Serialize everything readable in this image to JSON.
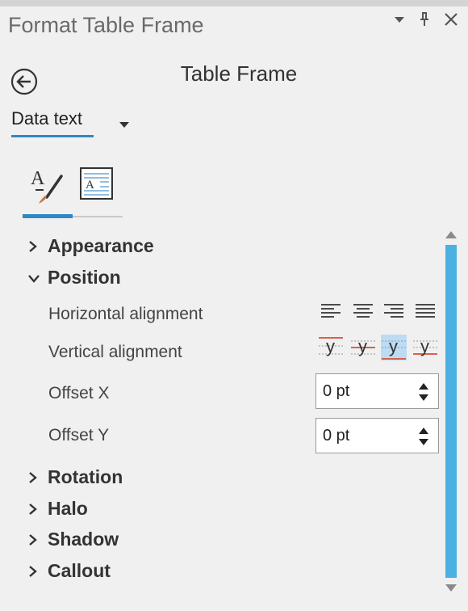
{
  "window": {
    "title": "Format Table Frame"
  },
  "header": {
    "section_title": "Table Frame"
  },
  "element_selector": {
    "value": "Data text"
  },
  "tool_tabs": [
    {
      "icon": "text-symbol-icon",
      "active": true
    },
    {
      "icon": "text-properties-icon",
      "active": false
    }
  ],
  "groups": {
    "appearance": {
      "label": "Appearance",
      "expanded": false
    },
    "position": {
      "label": "Position",
      "expanded": true
    },
    "rotation": {
      "label": "Rotation",
      "expanded": false
    },
    "halo": {
      "label": "Halo",
      "expanded": false
    },
    "shadow": {
      "label": "Shadow",
      "expanded": false
    },
    "callout": {
      "label": "Callout",
      "expanded": false
    }
  },
  "position": {
    "horizontal_alignment": {
      "label": "Horizontal alignment",
      "options": [
        "left",
        "center",
        "right",
        "justify"
      ]
    },
    "vertical_alignment": {
      "label": "Vertical alignment",
      "glyph": "y",
      "options": [
        "top",
        "center",
        "baseline",
        "bottom"
      ],
      "selected": "baseline"
    },
    "offset_x": {
      "label": "Offset X",
      "value": "0 pt"
    },
    "offset_y": {
      "label": "Offset Y",
      "value": "0 pt"
    }
  },
  "colors": {
    "accent": "#2f87c6",
    "scrollbar": "#4bb1e0",
    "selected_bg": "#bcdcf3",
    "baseline_red": "#d9624b"
  }
}
